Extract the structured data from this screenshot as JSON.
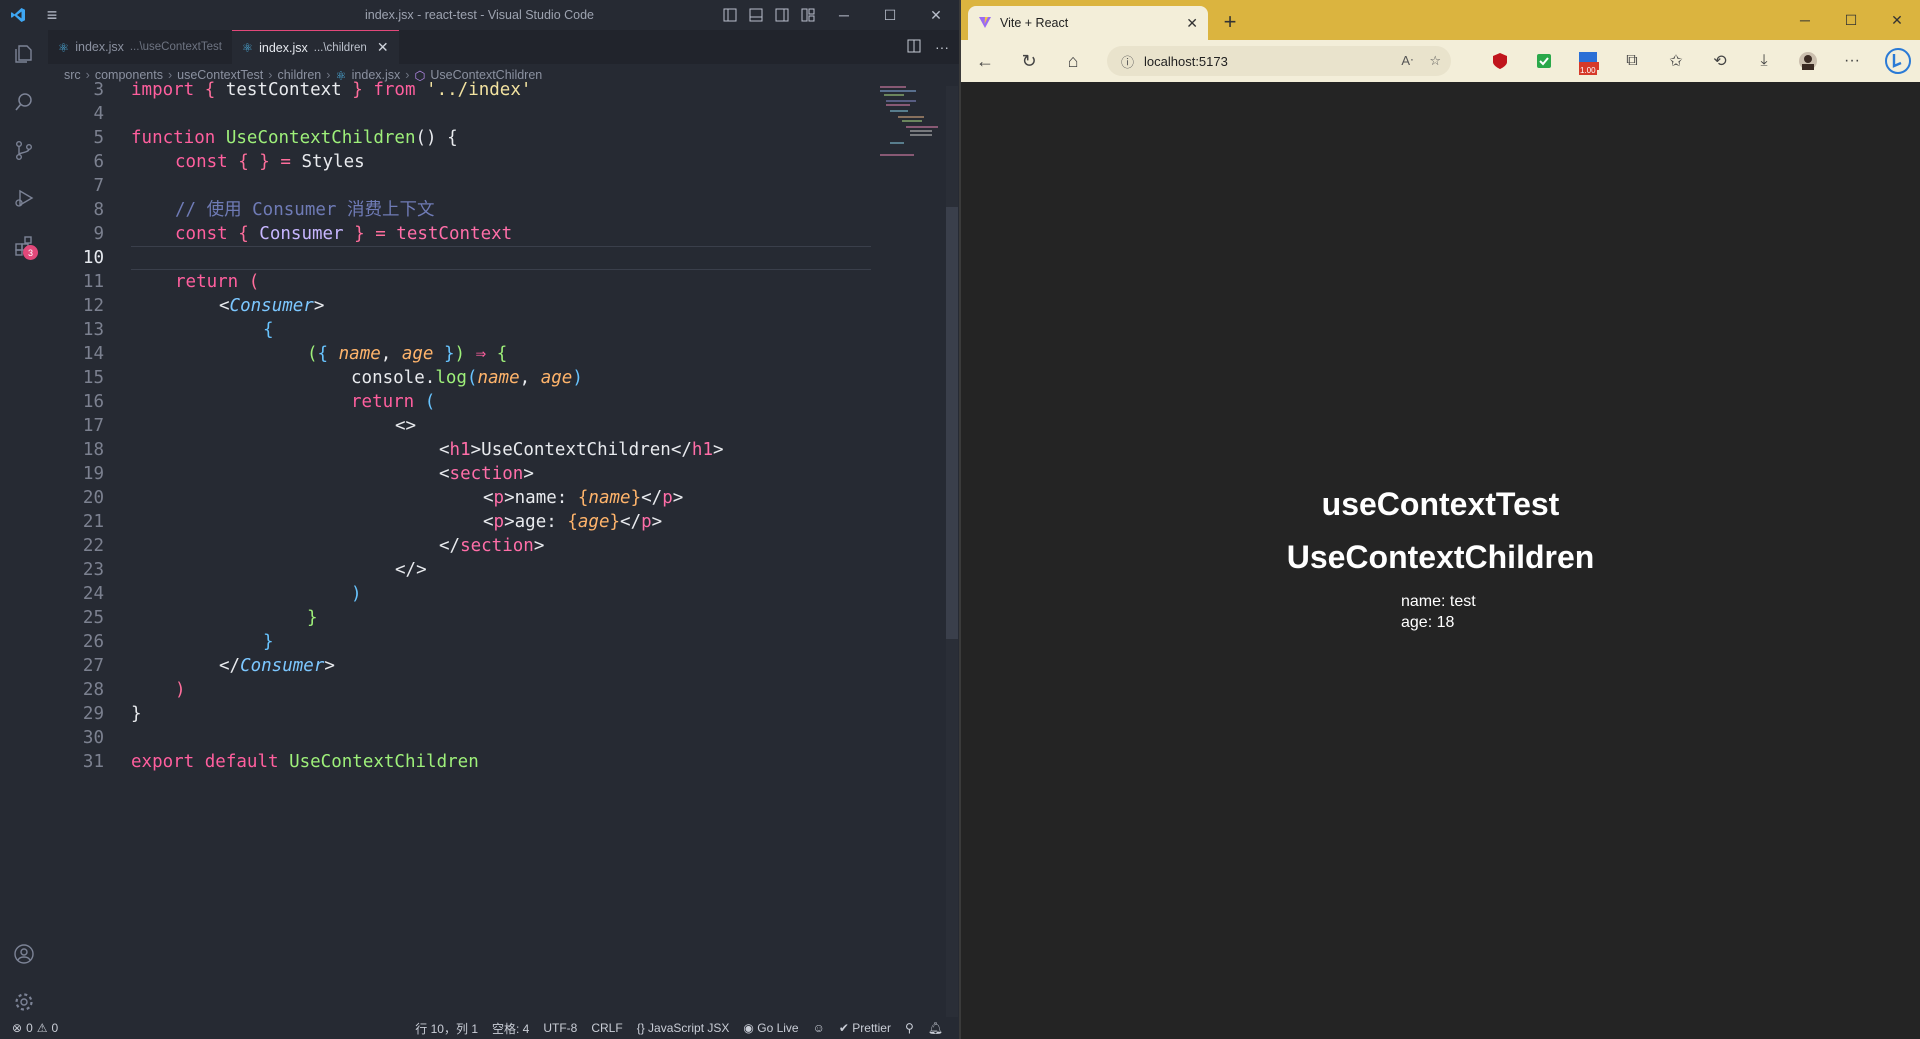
{
  "vscode": {
    "title": "index.jsx - react-test - Visual Studio Code",
    "tabs": [
      {
        "label": "index.jsx",
        "desc": "...\\useContextTest"
      },
      {
        "label": "index.jsx",
        "desc": "...\\children"
      }
    ],
    "breadcrumbs": [
      "src",
      "components",
      "useContextTest",
      "children",
      "index.jsx",
      "UseContextChildren"
    ],
    "extensions_badge": "3",
    "line_numbers": [
      "3",
      "4",
      "5",
      "6",
      "7",
      "8",
      "9",
      "10",
      "11",
      "12",
      "13",
      "14",
      "15",
      "16",
      "17",
      "18",
      "19",
      "20",
      "21",
      "22",
      "23",
      "24",
      "25",
      "26",
      "27",
      "28",
      "29",
      "30",
      "31"
    ],
    "code": {
      "l3": [
        "import",
        " { ",
        "testContext",
        " } ",
        "from",
        " ",
        "'../index'"
      ],
      "l5": [
        "function",
        " ",
        "UseContextChildren",
        "() {"
      ],
      "l6": [
        "const",
        " { } = ",
        "Styles"
      ],
      "l8": "// 使用 Consumer 消费上下文",
      "l9": [
        "const",
        " { ",
        "Consumer",
        " } = ",
        "testContext"
      ],
      "l11": [
        "return",
        " ("
      ],
      "l12": [
        "<",
        "Consumer",
        ">"
      ],
      "l13": "{",
      "l14": [
        "(",
        "{ ",
        "name",
        ", ",
        "age",
        " }",
        ")",
        " ⇒ ",
        "{"
      ],
      "l15": [
        "console",
        ".",
        "log",
        "(",
        "name",
        ", ",
        "age",
        ")"
      ],
      "l16": [
        "return",
        " ("
      ],
      "l17": "<>",
      "l18": [
        "<",
        "h1",
        ">",
        "UseContextChildren",
        "</",
        "h1",
        ">"
      ],
      "l19": [
        "<",
        "section",
        ">"
      ],
      "l20": [
        "<",
        "p",
        ">",
        "name: ",
        "{",
        "name",
        "}",
        "</",
        "p",
        ">"
      ],
      "l21": [
        "<",
        "p",
        ">",
        "age: ",
        "{",
        "age",
        "}",
        "</",
        "p",
        ">"
      ],
      "l22": [
        "</",
        "section",
        ">"
      ],
      "l23": "</>",
      "l24": ")",
      "l25": "}",
      "l26": "}",
      "l27": [
        "</",
        "Consumer",
        ">"
      ],
      "l28": ")",
      "l29": "}",
      "l31": [
        "export",
        " ",
        "default",
        " ",
        "UseContextChildren"
      ]
    },
    "status": {
      "errors": "0",
      "warnings": "0",
      "position": "行 10，列 1",
      "spaces": "空格: 4",
      "encoding": "UTF-8",
      "eol": "CRLF",
      "language": "JavaScript JSX",
      "golive": "Go Live",
      "prettier": "Prettier"
    }
  },
  "browser": {
    "tab_title": "Vite + React",
    "address": "localhost:5173",
    "ext_badge": "1.00",
    "page": {
      "h1_a": "useContextTest",
      "h1_b": "UseContextChildren",
      "p_name": "name: test",
      "p_age": "age: 18"
    }
  },
  "colors": {
    "accent": "#e2487a",
    "browser_frame": "#dbb43f"
  }
}
